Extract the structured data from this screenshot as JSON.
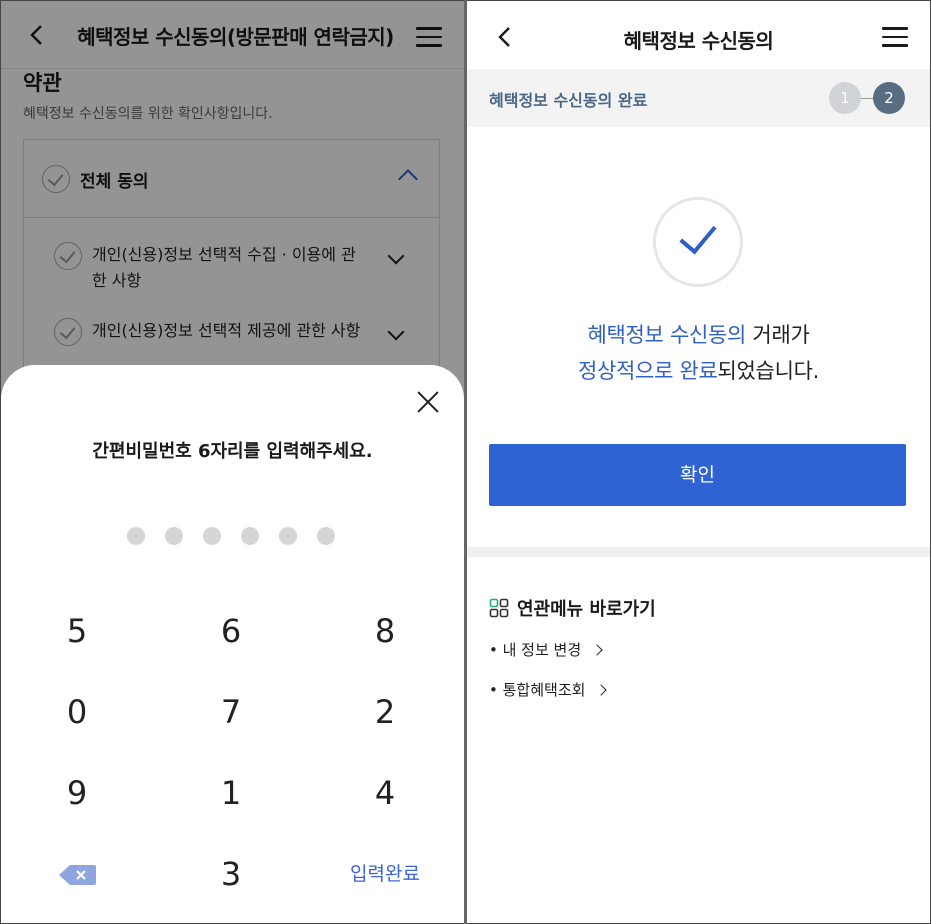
{
  "left": {
    "header": {
      "title": "혜택정보 수신동의(방문판매 연락금지)"
    },
    "terms": {
      "title": "약관",
      "subtitle": "혜택정보 수신동의를 위한 확인사항입니다.",
      "agree_all": "전체 동의",
      "items": [
        {
          "line1": "개인(신용)정보 선택적 수집 · 이용에 관",
          "line2": "한 사항"
        },
        {
          "line1": "개인(신용)정보 선택적 제공에 관한 사항"
        }
      ]
    },
    "pin_sheet": {
      "prompt": "간편비밀번호 6자리를 입력해주세요.",
      "dot_count": 6,
      "keys": [
        "5",
        "6",
        "8",
        "0",
        "7",
        "2",
        "9",
        "1",
        "4",
        "3"
      ],
      "done_label": "입력완료"
    }
  },
  "right": {
    "header": {
      "title": "혜택정보 수신동의"
    },
    "step": {
      "label": "혜택정보 수신동의 완료",
      "steps": [
        "1",
        "2"
      ],
      "current": 2
    },
    "message": {
      "line1_blue": "혜택정보 수신동의",
      "line1_rest": " 거래가",
      "line2_blue": "정상적으로 완료",
      "line2_rest": "되었습니다."
    },
    "confirm_label": "확인",
    "related": {
      "title": "연관메뉴 바로가기",
      "links": [
        "• 내 정보 변경",
        "• 통합혜택조회"
      ]
    }
  },
  "colors": {
    "accent": "#2f63d3",
    "step_active": "#576d82",
    "step_inactive": "#d0d3d7"
  }
}
